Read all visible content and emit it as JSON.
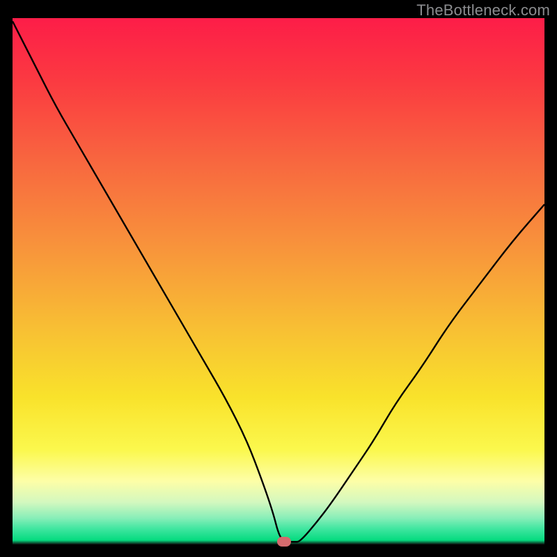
{
  "watermark": {
    "text": "TheBottleneck.com"
  },
  "chart_data": {
    "type": "line",
    "title": "",
    "xlabel": "",
    "ylabel": "",
    "xlim": [
      0,
      100
    ],
    "ylim": [
      0,
      100
    ],
    "grid": false,
    "legend": false,
    "background": {
      "kind": "vertical-gradient",
      "stops": [
        {
          "pct": 0,
          "color": "#fd1d48"
        },
        {
          "pct": 12,
          "color": "#fb3a41"
        },
        {
          "pct": 28,
          "color": "#f8693f"
        },
        {
          "pct": 44,
          "color": "#f8953b"
        },
        {
          "pct": 60,
          "color": "#f8c233"
        },
        {
          "pct": 72,
          "color": "#f9e22b"
        },
        {
          "pct": 82,
          "color": "#fbf84d"
        },
        {
          "pct": 88,
          "color": "#fdfea7"
        },
        {
          "pct": 92,
          "color": "#d3f8bf"
        },
        {
          "pct": 95,
          "color": "#87eeb8"
        },
        {
          "pct": 97,
          "color": "#40e6a0"
        },
        {
          "pct": 99.2,
          "color": "#05db7f"
        },
        {
          "pct": 100,
          "color": "#0d0d0d"
        }
      ]
    },
    "series": [
      {
        "name": "bottleneck-curve",
        "color": "#000000",
        "x": [
          0,
          4,
          8,
          12,
          16,
          20,
          24,
          28,
          32,
          36,
          40,
          44,
          47,
          49,
          50,
          51,
          53,
          54,
          57,
          60,
          64,
          68,
          72,
          77,
          82,
          88,
          94,
          100
        ],
        "y": [
          100,
          92,
          84,
          77,
          70,
          63,
          56,
          49,
          42,
          35,
          28,
          20,
          12,
          6,
          2,
          0.5,
          0.5,
          0.5,
          4,
          8,
          14,
          20,
          27,
          34,
          42,
          50,
          58,
          65
        ]
      }
    ],
    "marker": {
      "name": "optimal-point",
      "color": "#d46a6d",
      "x": 51,
      "y": 0.5,
      "shape": "pill"
    }
  }
}
